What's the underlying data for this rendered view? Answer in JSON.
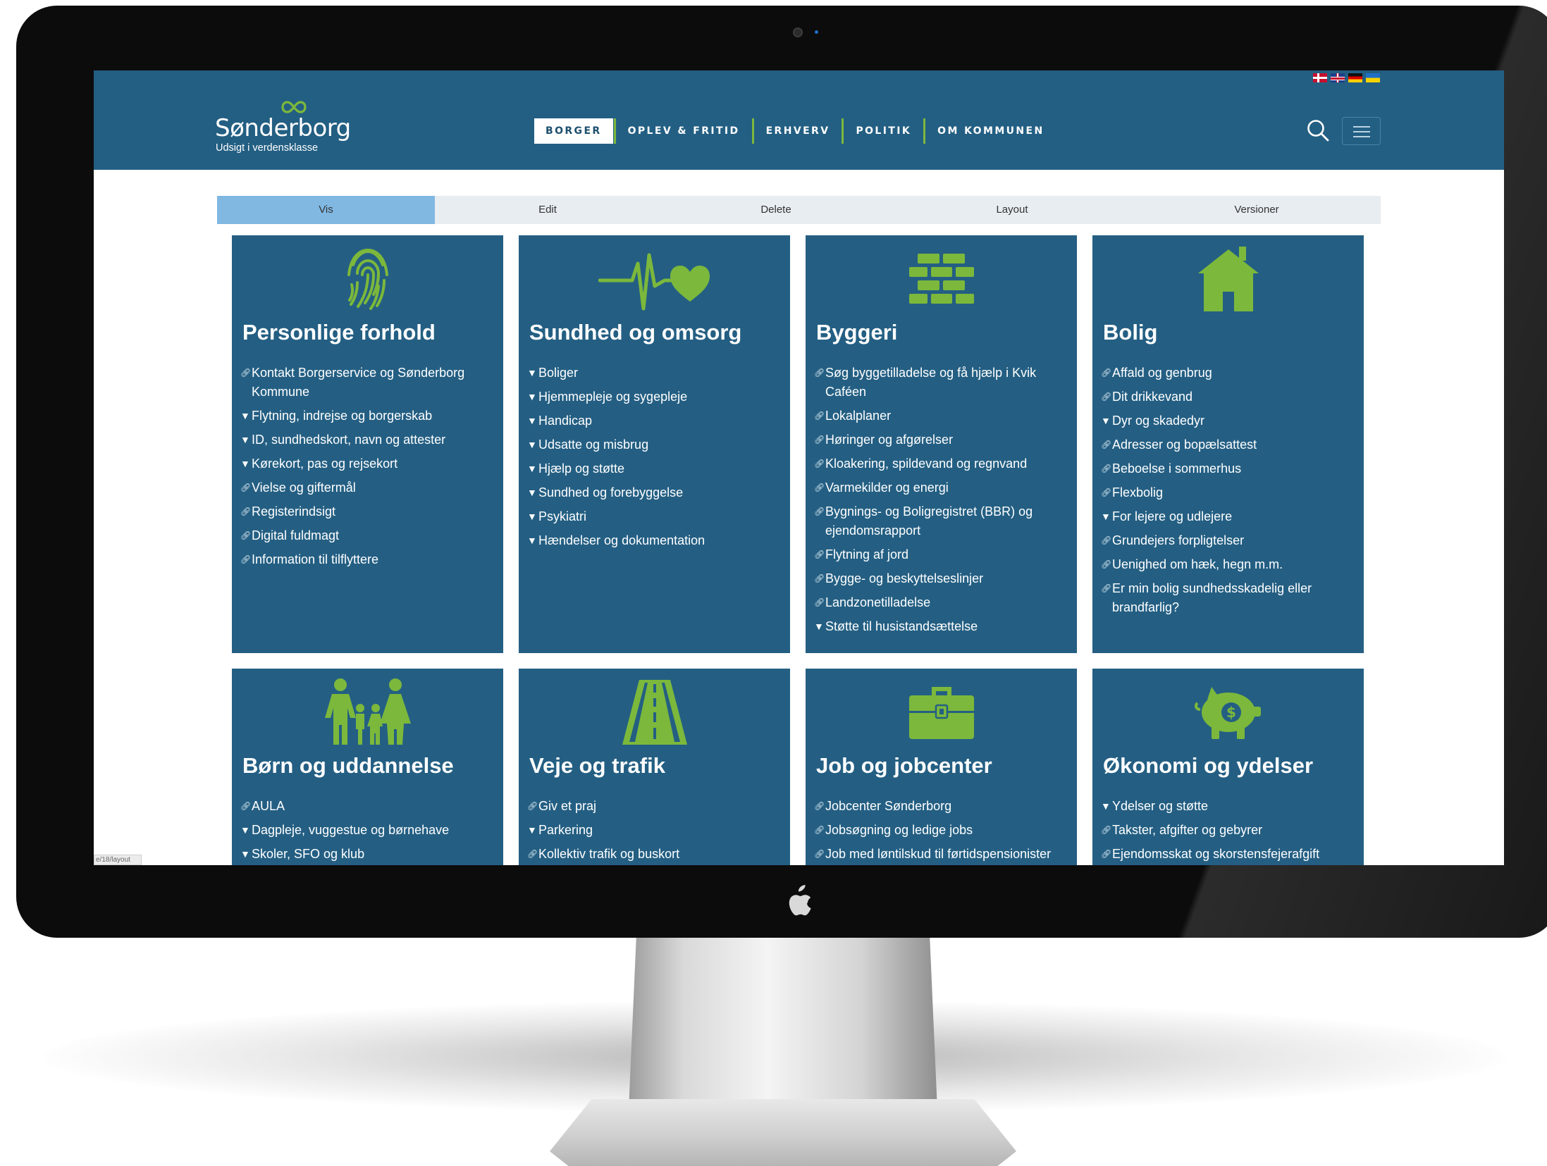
{
  "site": {
    "logo_name": "Sønderborg",
    "logo_tagline": "Udsigt i verdensklasse",
    "brand_color": "#235f83",
    "accent_color": "#7cb83b",
    "flags": [
      "flag-denmark-icon",
      "flag-uk-icon",
      "flag-germany-icon",
      "flag-ukraine-icon"
    ]
  },
  "nav": {
    "items": [
      {
        "label": "BORGER",
        "active": true
      },
      {
        "label": "OPLEV & FRITID"
      },
      {
        "label": "ERHVERV"
      },
      {
        "label": "POLITIK"
      },
      {
        "label": "OM KOMMUNEN"
      }
    ]
  },
  "admin_tabs": [
    {
      "label": "Vis",
      "active": true
    },
    {
      "label": "Edit"
    },
    {
      "label": "Delete"
    },
    {
      "label": "Layout"
    },
    {
      "label": "Versioner"
    }
  ],
  "cards": [
    {
      "title": "Personlige forhold",
      "icon": "fingerprint-icon",
      "items": [
        {
          "label": "Kontakt Borgerservice og Sønderborg Kommune",
          "type": "link"
        },
        {
          "label": "Flytning, indrejse og borgerskab",
          "type": "dropdown"
        },
        {
          "label": "ID, sundhedskort, navn og attester",
          "type": "dropdown"
        },
        {
          "label": "Kørekort, pas og rejsekort",
          "type": "dropdown"
        },
        {
          "label": "Vielse og giftermål",
          "type": "link"
        },
        {
          "label": "Registerindsigt",
          "type": "link"
        },
        {
          "label": "Digital fuldmagt",
          "type": "link"
        },
        {
          "label": "Information til tilflyttere",
          "type": "link"
        }
      ]
    },
    {
      "title": "Sundhed og omsorg",
      "icon": "heartbeat-icon",
      "items": [
        {
          "label": "Boliger",
          "type": "dropdown"
        },
        {
          "label": "Hjemmepleje og sygepleje",
          "type": "dropdown"
        },
        {
          "label": "Handicap",
          "type": "dropdown"
        },
        {
          "label": "Udsatte og misbrug",
          "type": "dropdown"
        },
        {
          "label": "Hjælp og støtte",
          "type": "dropdown"
        },
        {
          "label": "Sundhed og forebyggelse",
          "type": "dropdown"
        },
        {
          "label": "Psykiatri",
          "type": "dropdown"
        },
        {
          "label": "Hændelser og dokumentation",
          "type": "dropdown"
        }
      ]
    },
    {
      "title": "Byggeri",
      "icon": "brick-wall-icon",
      "items": [
        {
          "label": "Søg byggetilladelse og få hjælp i Kvik Caféen",
          "type": "link"
        },
        {
          "label": "Lokalplaner",
          "type": "link"
        },
        {
          "label": "Høringer og afgørelser",
          "type": "link"
        },
        {
          "label": "Kloakering, spildevand og regnvand",
          "type": "link"
        },
        {
          "label": "Varmekilder og energi",
          "type": "link"
        },
        {
          "label": "Bygnings- og Boligregistret (BBR) og ejendomsrapport",
          "type": "link"
        },
        {
          "label": "Flytning af jord",
          "type": "link"
        },
        {
          "label": "Bygge- og beskyttelseslinjer",
          "type": "link"
        },
        {
          "label": "Landzonetilladelse",
          "type": "link"
        },
        {
          "label": "Støtte til husistandsættelse",
          "type": "dropdown"
        }
      ]
    },
    {
      "title": "Bolig",
      "icon": "house-icon",
      "items": [
        {
          "label": "Affald og genbrug",
          "type": "link"
        },
        {
          "label": "Dit drikkevand",
          "type": "link"
        },
        {
          "label": "Dyr og skadedyr",
          "type": "dropdown"
        },
        {
          "label": "Adresser og bopælsattest",
          "type": "link"
        },
        {
          "label": "Beboelse i sommerhus",
          "type": "link"
        },
        {
          "label": "Flexbolig",
          "type": "link"
        },
        {
          "label": "For lejere og udlejere",
          "type": "dropdown"
        },
        {
          "label": "Grundejers forpligtelser",
          "type": "link"
        },
        {
          "label": "Uenighed om hæk, hegn m.m.",
          "type": "link"
        },
        {
          "label": "Er min bolig sundhedsskadelig eller brandfarlig?",
          "type": "link"
        }
      ]
    },
    {
      "title": "Børn og uddannelse",
      "icon": "family-icon",
      "items": [
        {
          "label": "AULA",
          "type": "link"
        },
        {
          "label": "Dagpleje, vuggestue og børnehave",
          "type": "dropdown"
        },
        {
          "label": "Skoler, SFO og klub",
          "type": "dropdown"
        }
      ]
    },
    {
      "title": "Veje og trafik",
      "icon": "road-icon",
      "items": [
        {
          "label": "Giv et praj",
          "type": "link"
        },
        {
          "label": "Parkering",
          "type": "dropdown"
        },
        {
          "label": "Kollektiv trafik og buskort",
          "type": "link"
        }
      ]
    },
    {
      "title": "Job og jobcenter",
      "icon": "briefcase-icon",
      "items": [
        {
          "label": "Jobcenter Sønderborg",
          "type": "link"
        },
        {
          "label": "Jobsøgning og ledige jobs",
          "type": "link"
        },
        {
          "label": "Job med løntilskud til førtidspensionister",
          "type": "link"
        }
      ]
    },
    {
      "title": "Økonomi og ydelser",
      "icon": "piggy-bank-icon",
      "items": [
        {
          "label": "Ydelser og støtte",
          "type": "dropdown"
        },
        {
          "label": "Takster, afgifter og gebyrer",
          "type": "link"
        },
        {
          "label": "Ejendomsskat og skorstensfejerafgift",
          "type": "link"
        }
      ]
    }
  ],
  "status_url": "e/18/layout"
}
